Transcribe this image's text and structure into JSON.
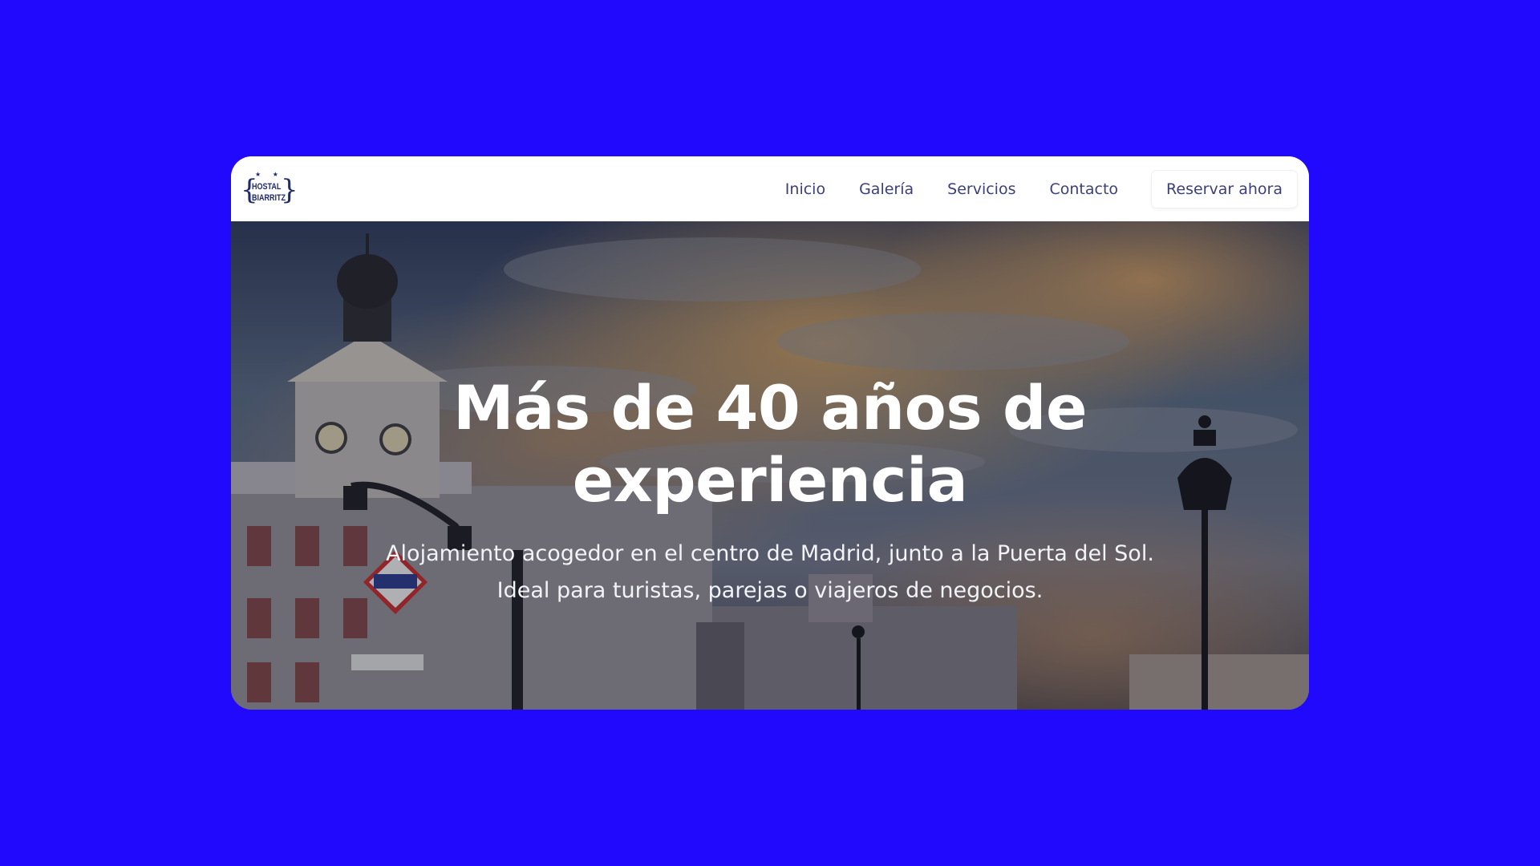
{
  "logo": {
    "line1": "HOSTAL",
    "line2": "BIARRITZ",
    "stars": "★ ★"
  },
  "nav": {
    "items": [
      {
        "label": "Inicio"
      },
      {
        "label": "Galería"
      },
      {
        "label": "Servicios"
      },
      {
        "label": "Contacto"
      }
    ],
    "cta_label": "Reservar ahora"
  },
  "hero": {
    "title": "Más de 40 años de experiencia",
    "subtitle": "Alojamiento acogedor en el centro de Madrid, junto a la Puerta del Sol. Ideal para turistas, parejas o viajeros de negocios.",
    "background_description_icon": "puerta-del-sol-photo"
  },
  "colors": {
    "page_background": "#2109FD",
    "nav_text": "#3b3f7a",
    "logo": "#1f2a6b",
    "hero_text": "#ffffff"
  }
}
